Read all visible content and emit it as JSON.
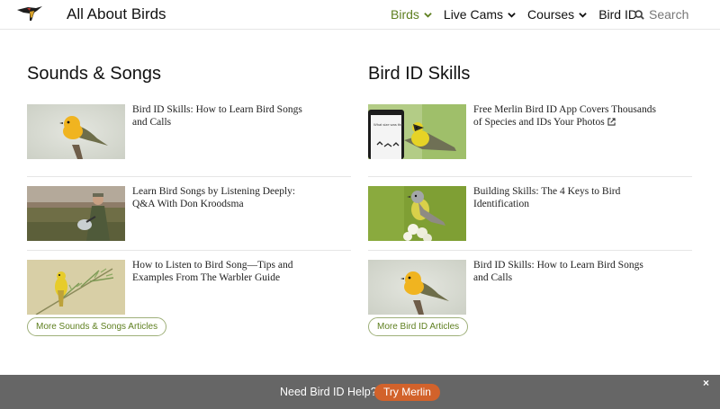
{
  "header": {
    "site_title": "All About Birds",
    "nav": [
      {
        "label": "Birds",
        "active": true,
        "has_dropdown": true
      },
      {
        "label": "Live Cams",
        "active": false,
        "has_dropdown": true
      },
      {
        "label": "Courses",
        "active": false,
        "has_dropdown": true
      },
      {
        "label": "Bird ID",
        "active": false,
        "has_dropdown": false
      }
    ],
    "search_label": "Search",
    "icons": {
      "logo": "bird-logo-icon",
      "search": "search-icon",
      "dropdown": "chevron-down-icon"
    }
  },
  "sounds": {
    "title": "Sounds & Songs",
    "articles": [
      {
        "title": "Bird ID Skills: How to Learn Bird Songs and Calls",
        "thumbnail": "yellow-warbler-photo"
      },
      {
        "title": "Learn Bird Songs by Listening Deeply: Q&A With Don Kroodsma",
        "thumbnail": "man-with-microphone-photo"
      },
      {
        "title": "How to Listen to Bird Song—Tips and Examples From The Warbler Guide",
        "thumbnail": "warbler-on-branch-photo"
      }
    ],
    "more_label": "More Sounds & Songs Articles"
  },
  "birdid": {
    "title": "Bird ID Skills",
    "articles": [
      {
        "title": "Free Merlin Bird ID App Covers Thousands of Species and IDs Your Photos",
        "thumbnail": "merlin-app-phone-photo",
        "external": true
      },
      {
        "title": "Building Skills: The 4 Keys to Bird Identification",
        "thumbnail": "kingbird-on-flowers-photo"
      },
      {
        "title": "Bird ID Skills: How to Learn Bird Songs and Calls",
        "thumbnail": "yellow-warbler-photo"
      }
    ],
    "more_label": "More Bird ID Articles"
  },
  "banner": {
    "text": "Need Bird ID Help?",
    "button_label": "Try Merlin",
    "close_label": "×"
  },
  "colors": {
    "accent_green": "#5e7f1f",
    "banner_bg": "#666666",
    "cta_orange": "#d2622b"
  }
}
